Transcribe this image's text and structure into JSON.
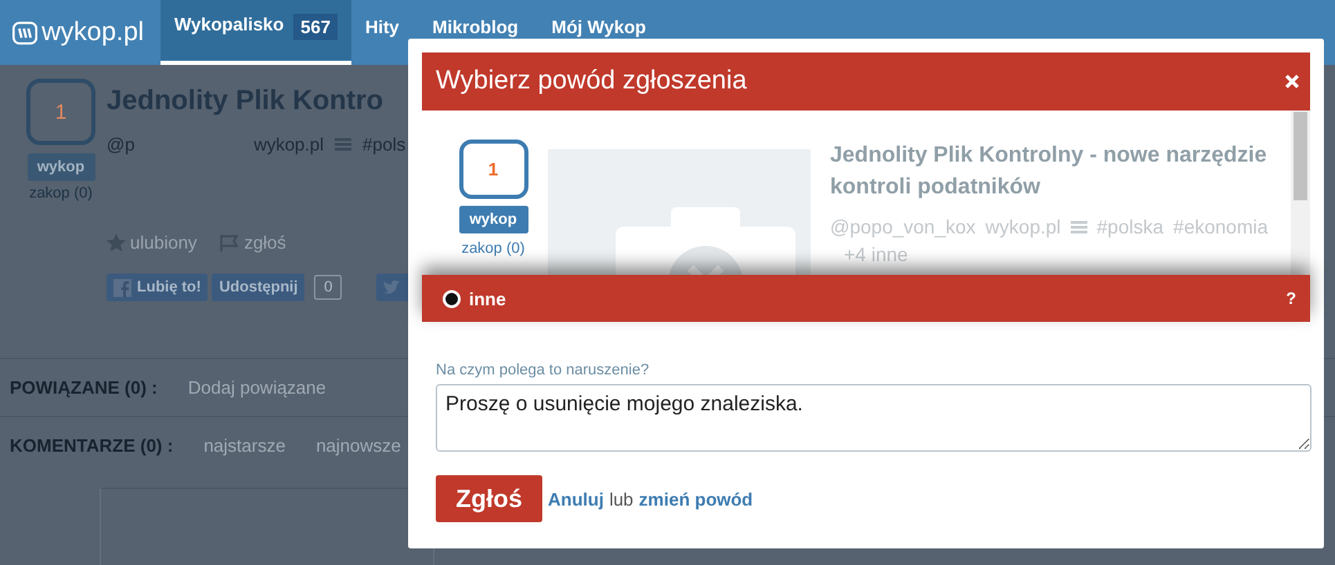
{
  "header": {
    "logo": "wykop.pl",
    "tabs": [
      {
        "label": "Wykopalisko",
        "count": "567",
        "selected": true
      },
      {
        "label": "Hity",
        "selected": false
      },
      {
        "label": "Mikroblog",
        "selected": false
      },
      {
        "label": "Mój Wykop",
        "selected": false
      }
    ]
  },
  "background_post": {
    "votes": "1",
    "vote_button": "wykop",
    "bury": "zakop (0)",
    "title": "Jednolity Plik Kontro",
    "author": "@p",
    "source": "wykop.pl",
    "tag": "#pols",
    "actions": [
      "ulubiony",
      "zgłoś"
    ],
    "like": "Lubię to!",
    "share": "Udostępnij",
    "share_count": "0"
  },
  "related": {
    "label": "POWIĄZANE (0) :",
    "link": "Dodaj powiązane"
  },
  "comments": {
    "label": "KOMENTARZE (0) :",
    "sorts": [
      "najstarsze",
      "najnowsze"
    ]
  },
  "modal": {
    "title": "Wybierz powód zgłoszenia",
    "post": {
      "votes": "1",
      "vote_button": "wykop",
      "bury": "zakop (0)",
      "title": "Jednolity Plik Kontrolny - nowe narzędzie kontroli podatników",
      "author": "@popo_von_kox",
      "source": "wykop.pl",
      "tags": [
        "#polska",
        "#ekonomia"
      ],
      "more": "+4 inne"
    },
    "reason": {
      "label": "inne",
      "selected": true,
      "help": "?"
    },
    "field_label": "Na czym polega to naruszenie?",
    "value": "Proszę o usunięcie mojego znaleziska.",
    "submit": "Zgłoś",
    "cancel": "Anuluj",
    "or": "lub",
    "change": "zmień powód"
  }
}
